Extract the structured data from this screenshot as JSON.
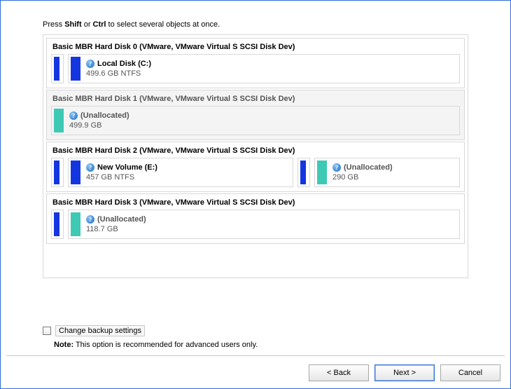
{
  "hint": {
    "pre": "Press ",
    "k1": "Shift",
    "mid": " or ",
    "k2": "Ctrl",
    "post": " to select several objects at once."
  },
  "disks": {
    "d0": {
      "title": "Basic MBR Hard Disk 0 (VMware, VMware Virtual S SCSI Disk Dev)",
      "v0": {
        "name": "Local Disk (C:)",
        "sub": "499.6 GB NTFS"
      }
    },
    "d1": {
      "title": "Basic MBR Hard Disk 1 (VMware, VMware Virtual S SCSI Disk Dev)",
      "v0": {
        "name": "(Unallocated)",
        "sub": "499.9 GB"
      }
    },
    "d2": {
      "title": "Basic MBR Hard Disk 2 (VMware, VMware Virtual S SCSI Disk Dev)",
      "v0": {
        "name": "New Volume (E:)",
        "sub": "457 GB NTFS"
      },
      "v1": {
        "name": "(Unallocated)",
        "sub": "290 GB"
      }
    },
    "d3": {
      "title": "Basic MBR Hard Disk 3 (VMware, VMware Virtual S SCSI Disk Dev)",
      "v0": {
        "name": "(Unallocated)",
        "sub": "118.7 GB"
      }
    }
  },
  "change_label": "Change backup settings",
  "note_label": "Note:",
  "note_text": " This option is recommended for advanced users only.",
  "buttons": {
    "back": "< Back",
    "next": "Next >",
    "cancel": "Cancel"
  },
  "colors": {
    "blue": "#1436e0",
    "teal": "#3ec9b5",
    "border": "#2c6fd6"
  }
}
